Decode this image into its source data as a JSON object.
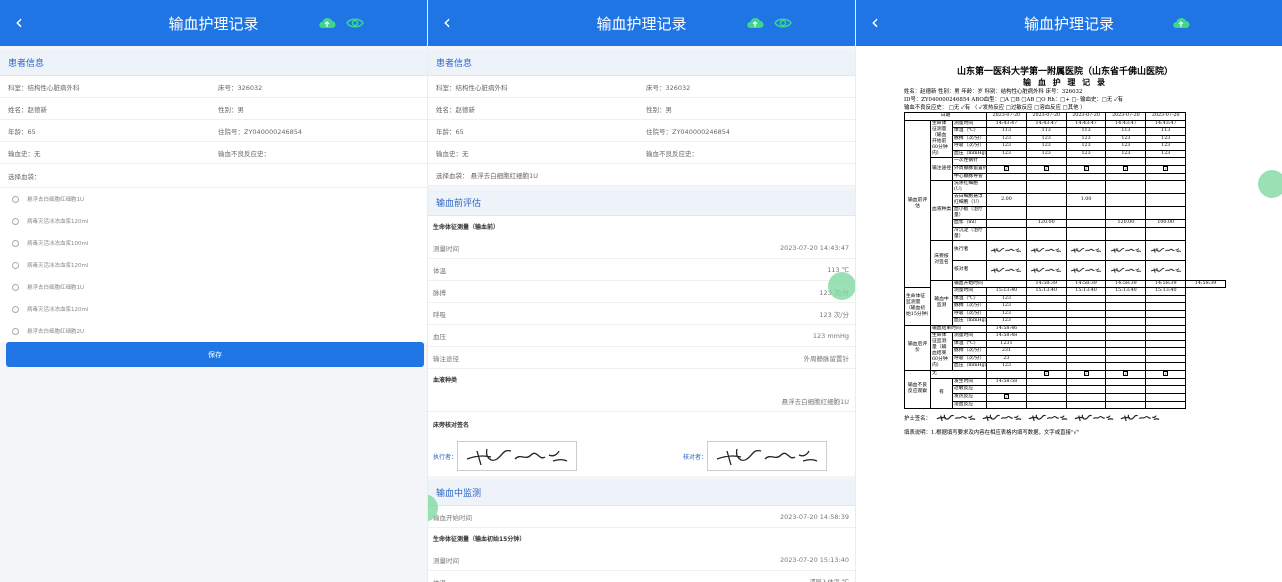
{
  "header": {
    "title": "输血护理记录"
  },
  "patient": {
    "section": "患者信息",
    "rows": [
      [
        "科室：结构性心脏病外科",
        "床号：326032"
      ],
      [
        "姓名：赵德新",
        "性别：男"
      ],
      [
        "年龄：65",
        "住院号：ZY040000246854"
      ],
      [
        "输血史：无",
        "输血不良反应史："
      ]
    ],
    "blood_label": "选择血袋：",
    "bags": [
      "悬浮去白细胞红细胞1U",
      "病毒灭活冰冻血浆120ml",
      "病毒灭活冰冻血浆100ml",
      "病毒灭活冰冻血浆120ml",
      "悬浮去白细胞红细胞1U",
      "病毒灭活冰冻血浆120ml",
      "悬浮去白细胞红细胞2U"
    ],
    "save": "保存"
  },
  "middle": {
    "blood_bag": "选择血袋：  悬浮去白细胞红细胞1U",
    "pre_section": "输血前评估",
    "vital_title": "生命体征测量（输血前）",
    "vitals": [
      [
        "测量时间",
        "2023-07-20 14:43:47"
      ],
      [
        "体温",
        "113 ℃"
      ],
      [
        "脉搏",
        "123 次/分"
      ],
      [
        "呼吸",
        "123 次/分"
      ],
      [
        "血压",
        "123 mmHg"
      ],
      [
        "输注途径",
        "外周静脉留置针"
      ]
    ],
    "blood_type_title": "血液种类",
    "blood_type_value": "悬浮去白细胞红细胞1U",
    "sign_title": "床旁核对签名",
    "executor": "执行者：",
    "checker": "核对者：",
    "mid_section": "输血中监测",
    "start_label": "输血开始时间",
    "start_value": "2023-07-20 14:58:39",
    "mid_vital_title": "生命体征测量（输血初始15分钟）",
    "mid_time_label": "测量时间",
    "mid_time_value": "2023-07-20 15:13:40",
    "temp_label": "体温",
    "temp_placeholder": "请输入体温",
    "temp_unit": "℃"
  },
  "doc": {
    "hospital": "山东第一医科大学第一附属医院（山东省千佛山医院）",
    "title": "输 血 护 理 记 录",
    "line1": "姓名：赵德新    性别：男  年龄：岁    科别：结构性心脏病外科    床号：326032",
    "line2": "ID号：ZY040000246854        ABO血型：□A  □B  □AB  □O  Rh：□+ □-  输血史：□无 ✓有",
    "line3": "输血不良反应史：  □无 ✓有 （ ✓发热反应  □过敏反应  □溶血反应  □其他 ）",
    "date_label": "日期",
    "dates": [
      "2023-07-20",
      "2023-07-20",
      "2023-07-20",
      "2023-07-20",
      "2023-07-20"
    ],
    "pre_rows": [
      [
        "测量时间",
        "14:43:47",
        "14:43:47",
        "14:43:47",
        "14:43:47",
        "14:43:47"
      ],
      [
        "体温（℃）",
        "113",
        "113",
        "113",
        "113",
        "113"
      ],
      [
        "脉搏（次/分）",
        "123",
        "123",
        "123",
        "123",
        "123"
      ],
      [
        "呼吸（次/分）",
        "123",
        "123",
        "123",
        "123",
        "123"
      ],
      [
        "血压（mmHg）",
        "123",
        "123",
        "123",
        "123",
        "123"
      ]
    ],
    "pre_group": "输血前评估",
    "vital_group": "生命体征测量（输血开始前60分钟内）",
    "route_group": "输注途径",
    "routes": [
      "一次性钢针",
      "外周静脉留置针",
      "中心静脉导管"
    ],
    "blood_group": "血液种类",
    "bloods": [
      [
        "洗涤红细胞(U)",
        "",
        "",
        "",
        "",
        ""
      ],
      [
        "去白细胞悬浮红细胞（U）",
        "2.00",
        "",
        "1.00",
        "",
        ""
      ],
      [
        "血小板（治疗量）",
        "",
        "",
        "",
        "",
        ""
      ],
      [
        "血浆（ml）",
        "",
        "120.00",
        "",
        "120.00",
        "100.00"
      ],
      [
        "冷沉淀（治疗量）",
        "",
        "",
        "",
        "",
        ""
      ]
    ],
    "bedside": "床旁核对签名",
    "executor": "执行者",
    "checker": "核对者",
    "mid_group": "输血中监测",
    "start_time": "输血开始时间",
    "starts": [
      "14:58:39",
      "14:58:39",
      "14:58:39",
      "14:58:39",
      "14:58:39"
    ],
    "mid_vital": "生命体征监测量（输血初始15分钟）",
    "mid_rows": [
      [
        "测量时间",
        "15:13:40",
        "15:13:40",
        "15:13:40",
        "15:13:40",
        "15:13:40"
      ],
      [
        "体温（℃）",
        "123",
        "",
        "",
        "",
        ""
      ],
      [
        "脉搏（次/分）",
        "123",
        "",
        "",
        "",
        ""
      ],
      [
        "呼吸（次/分）",
        "123",
        "",
        "",
        "",
        ""
      ],
      [
        "血压（mmHg）",
        "123",
        "",
        "",
        "",
        ""
      ]
    ],
    "post_group": "输血后评价",
    "end_time": "输血结束时间",
    "end_value": "14:58:46",
    "post_vital": "生命体征监测量（输血结束60分钟内）",
    "post_rows": [
      [
        "测量时间",
        "14:58:48",
        "",
        "",
        "",
        ""
      ],
      [
        "体温（℃）",
        "1231",
        "",
        "",
        "",
        ""
      ],
      [
        "脉搏（次/分）",
        "231",
        "",
        "",
        "",
        ""
      ],
      [
        "呼吸（次/分）",
        "23",
        "",
        "",
        "",
        ""
      ],
      [
        "血压（mmHg）",
        "123",
        "",
        "",
        "",
        ""
      ]
    ],
    "adverse_group": "输血不良反应观察",
    "none": "无",
    "have": "有",
    "adverse_rows": [
      "发生时间",
      "过敏反应",
      "发热反应",
      "溶血反应"
    ],
    "adverse_time": "14:58:58",
    "nurse": "护士签名：",
    "note": "填表说明：1.根据填写要求及内容在相应表格内填写数据，文字或直接\"√\""
  }
}
